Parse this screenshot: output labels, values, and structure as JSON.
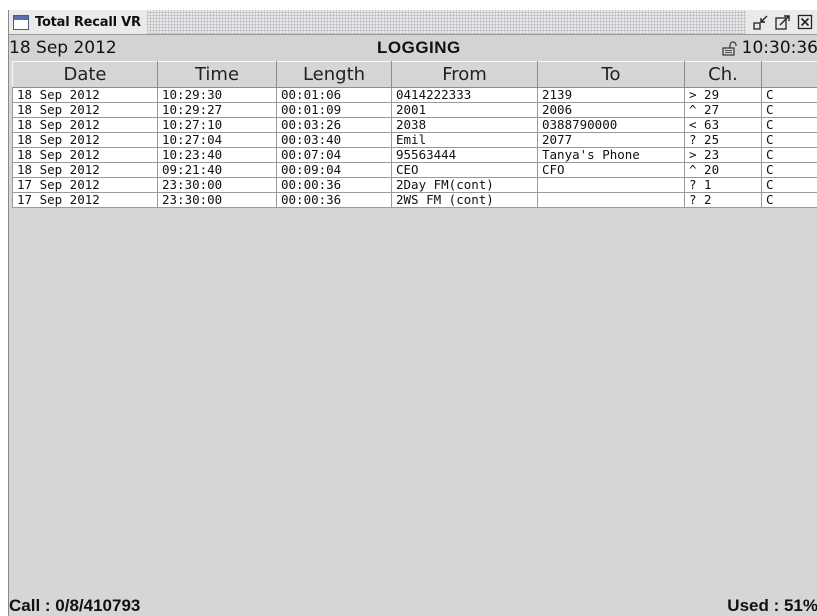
{
  "window": {
    "title": "Total Recall VR",
    "icon": "window-app-icon",
    "buttons": [
      "minimize-icon",
      "maximize-icon",
      "close-icon"
    ]
  },
  "header": {
    "date": "18 Sep 2012",
    "mode": "LOGGING",
    "time": "10:30:36",
    "lock_icon": "unlocked-padlock-icon"
  },
  "table": {
    "columns": [
      "Date",
      "Time",
      "Length",
      "From",
      "To",
      "Ch.",
      ""
    ],
    "rows": [
      [
        "18 Sep 2012",
        "10:29:30",
        "00:01:06",
        "0414222333",
        "2139",
        "> 29",
        "C"
      ],
      [
        "18 Sep 2012",
        "10:29:27",
        "00:01:09",
        "2001",
        "2006",
        "^ 27",
        "C"
      ],
      [
        "18 Sep 2012",
        "10:27:10",
        "00:03:26",
        "2038",
        "0388790000",
        "< 63",
        "C"
      ],
      [
        "18 Sep 2012",
        "10:27:04",
        "00:03:40",
        "Emil",
        "2077",
        "? 25",
        "C"
      ],
      [
        "18 Sep 2012",
        "10:23:40",
        "00:07:04",
        "95563444",
        "Tanya's Phone",
        "> 23",
        "C"
      ],
      [
        "18 Sep 2012",
        "09:21:40",
        "00:09:04",
        "CEO",
        "CFO",
        "^ 20",
        "C"
      ],
      [
        "17 Sep 2012",
        "23:30:00",
        "00:00:36",
        "2Day FM(cont)",
        "",
        "? 1",
        "C"
      ],
      [
        "17 Sep 2012",
        "23:30:00",
        "00:00:36",
        "2WS FM (cont)",
        "",
        "? 2",
        "C"
      ]
    ]
  },
  "footer": {
    "call": "Call : 0/8/410793",
    "used": "Used : 51%"
  },
  "colors": {
    "panel": "#d6d6d6",
    "table_bg": "#ffffff",
    "icon_blue": "#5b6fa6"
  }
}
